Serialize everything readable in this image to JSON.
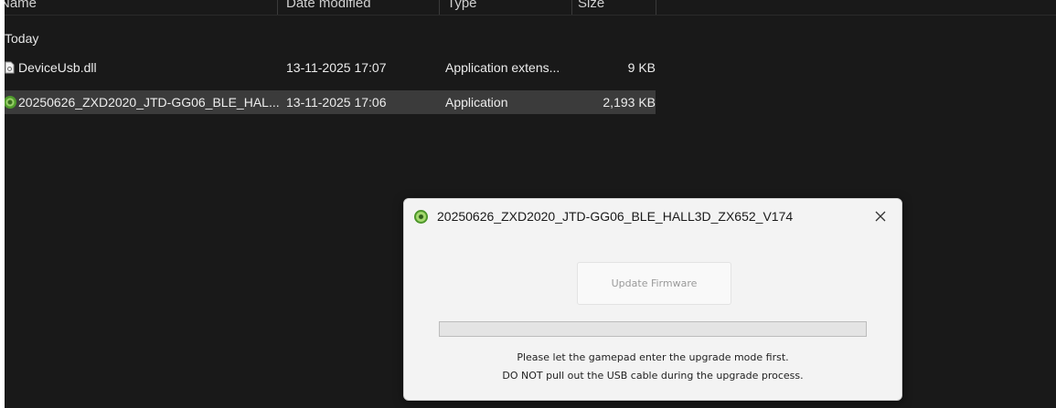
{
  "columns": {
    "name": "Name",
    "date_modified": "Date modified",
    "type": "Type",
    "size": "Size"
  },
  "group": {
    "label": "Today"
  },
  "files": [
    {
      "name": "DeviceUsb.dll",
      "date": "13-11-2025 17:07",
      "type": "Application extens...",
      "size": "9 KB",
      "icon": "dll-file-icon",
      "selected": false
    },
    {
      "name": "20250626_ZXD2020_JTD-GG06_BLE_HAL...",
      "date": "13-11-2025 17:06",
      "type": "Application",
      "size": "2,193 KB",
      "icon": "app-icon",
      "selected": true
    }
  ],
  "dialog": {
    "title": "20250626_ZXD2020_JTD-GG06_BLE_HALL3D_ZX652_V174",
    "close_icon": "close-icon",
    "update_button_label": "Update Firmware",
    "update_button_enabled": false,
    "progress": 0,
    "message_line1": "Please let the gamepad enter the upgrade mode first.",
    "message_line2": "DO NOT pull out the USB cable during the upgrade process."
  },
  "colors": {
    "explorer_bg": "#191919",
    "selected_row_bg": "#3b3b3b",
    "dialog_bg": "#f3f3f3",
    "app_icon_green": "#4e9a2a"
  }
}
